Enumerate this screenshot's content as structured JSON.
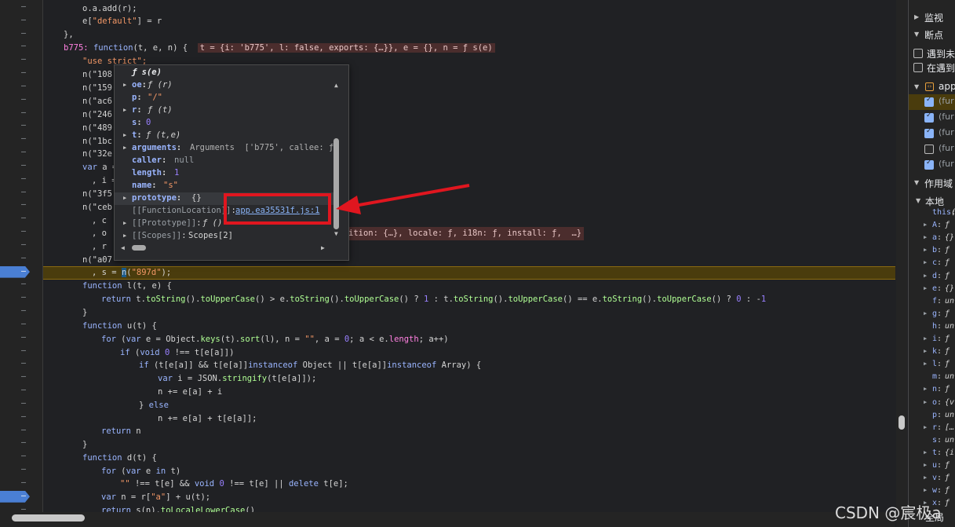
{
  "gutter": {
    "breakpoint_rows": [
      20,
      37
    ]
  },
  "code": {
    "l0": "o.a.add(r);",
    "l1a": "e[",
    "l1b": "\"default\"",
    "l1c": "] = r",
    "l2": "},",
    "l3a": "b775: ",
    "l3b": "function",
    "l3c": "(t, e, n) {",
    "l3d": "t = {i: 'b775', l: false, exports: {…}}, e = {}, n = ƒ s(e)",
    "l4": "\"use strict\";",
    "l5": "n(\"108",
    "l6": "n(\"159",
    "l7": "n(\"ac6",
    "l8": "n(\"246",
    "l9": "n(\"489",
    "l10": "n(\"1bc",
    "l11": "n(\"32e",
    "l12a": "var",
    "l12b": " a =",
    "l13": ", i =",
    "l14": "n(\"3f5",
    "l15": "n(\"ceb",
    "l16": ", c",
    "l17": ", o",
    "l17b": "ition: {…}, locale: ƒ, i18n: ƒ, install: ƒ,  …}",
    "l18": ", r",
    "l19": "n(\"a07",
    "l20a": ", s = ",
    "l20b": "n",
    "l20c": "(",
    "l20d": "\"897d\"",
    "l20e": ");",
    "l21a": "function",
    "l21b": " l(t, e) {",
    "l22a": "return",
    "l22b": " t.",
    "l22c": "toString",
    "l22d": "().",
    "l22e": "toUpperCase",
    "l22f": "() > e.",
    "l22g": "toString",
    "l22h": "().",
    "l22i": "toUpperCase",
    "l22j": "() ? ",
    "l22k": "1",
    "l22l": " : t.",
    "l22m": "toString",
    "l22n": "().",
    "l22o": "toUpperCase",
    "l22p": "() == e.",
    "l22q": "toString",
    "l22r": "().",
    "l22s": "toUpperCase",
    "l22t": "() ? ",
    "l22u": "0",
    "l22v": " : -",
    "l22w": "1",
    "l23": "}",
    "l24a": "function",
    "l24b": " u(t) {",
    "l25a": "for",
    "l25b": " (",
    "l25c": "var",
    "l25d": " e = Object.",
    "l25e": "keys",
    "l25f": "(t).",
    "l25g": "sort",
    "l25h": "(l), n = ",
    "l25i": "\"\"",
    "l25j": ", a = ",
    "l25k": "0",
    "l25l": "; a < e.",
    "l25m": "length",
    "l25n": "; a++)",
    "l26a": "if",
    "l26b": " (",
    "l26c": "void",
    "l26d": " ",
    "l26e": "0",
    "l26f": " !== t[e[a]])",
    "l27a": "if",
    "l27b": " (t[e[a]] && t[e[a]]",
    "l27c": "instanceof",
    "l27d": " Object || t[e[a]]",
    "l27e": "instanceof",
    "l27f": " Array) {",
    "l28a": "var",
    "l28b": " i = JSON.",
    "l28c": "stringify",
    "l28d": "(t[e[a]]);",
    "l29": "n += e[a] + i",
    "l30a": "} ",
    "l30b": "else",
    "l31": "n += e[a] + t[e[a]];",
    "l32a": "return",
    "l32b": " n",
    "l33": "}",
    "l34a": "function",
    "l34b": " d(t) {",
    "l35a": "for",
    "l35b": " (",
    "l35c": "var",
    "l35d": " e ",
    "l35e": "in",
    "l35f": " t)",
    "l36a": "\"\"",
    "l36b": " !== t[e] && ",
    "l36c": "void",
    "l36d": " ",
    "l36e": "0",
    "l36f": " !== t[e] || ",
    "l36g": "delete",
    "l36h": " t[e];",
    "l37a": "var",
    "l37b": " n = ",
    "l37c": "r[",
    "l37d": "\"a\"",
    "l37e": "] + ",
    "l37f": "u(t);",
    "l38a": "return",
    "l38b": " s(n).",
    "l38c": "toLocaleLowerCase",
    "l38d": "()"
  },
  "tooltip": {
    "title": "ƒ s(e)",
    "rows": [
      {
        "key": "oe",
        "val": "ƒ (r)"
      },
      {
        "key": "p",
        "val": "\"/\""
      },
      {
        "key": "r",
        "val": "ƒ (t)"
      },
      {
        "key": "s",
        "val": "0"
      },
      {
        "key": "t",
        "val": "ƒ (t,e)"
      },
      {
        "key": "arguments",
        "val": "Arguments  ['b775', callee: ƒ,"
      },
      {
        "key": "caller",
        "val": "null"
      },
      {
        "key": "length",
        "val": "1"
      },
      {
        "key": "name",
        "val": "\"s\""
      },
      {
        "key": "prototype",
        "val": "{}"
      },
      {
        "key": "[[FunctionLocation]]",
        "val": "app.ea35531f.js:1"
      },
      {
        "key": "[[Prototype]]",
        "val": "ƒ ()"
      },
      {
        "key": "[[Scopes]]",
        "val": "Scopes[2]"
      }
    ]
  },
  "sidebar": {
    "watch": "监视",
    "breakpoints": "断点",
    "pause_uncaught": "遇到未",
    "pause_caught": "在遇到",
    "file": "app",
    "fn": "(fur",
    "bp_checked": [
      true,
      true,
      true,
      false,
      true
    ],
    "scope": "作用域",
    "local": "本地",
    "vars": [
      {
        "k": "this",
        "v": "("
      },
      {
        "k": "A",
        "v": "ƒ"
      },
      {
        "k": "a",
        "v": "{}"
      },
      {
        "k": "b",
        "v": "ƒ"
      },
      {
        "k": "c",
        "v": "ƒ"
      },
      {
        "k": "d",
        "v": "ƒ"
      },
      {
        "k": "e",
        "v": "{}"
      },
      {
        "k": "f",
        "v": "un"
      },
      {
        "k": "g",
        "v": "ƒ"
      },
      {
        "k": "h",
        "v": "un"
      },
      {
        "k": "i",
        "v": "ƒ"
      },
      {
        "k": "k",
        "v": "ƒ"
      },
      {
        "k": "l",
        "v": "ƒ"
      },
      {
        "k": "m",
        "v": "un"
      },
      {
        "k": "n",
        "v": "ƒ"
      },
      {
        "k": "o",
        "v": "{v"
      },
      {
        "k": "p",
        "v": "un"
      },
      {
        "k": "r",
        "v": "[…"
      },
      {
        "k": "s",
        "v": "un"
      },
      {
        "k": "t",
        "v": "{i"
      },
      {
        "k": "u",
        "v": "ƒ"
      },
      {
        "k": "v",
        "v": "ƒ"
      },
      {
        "k": "w",
        "v": "ƒ"
      },
      {
        "k": "x",
        "v": "ƒ"
      }
    ],
    "global": "全局"
  },
  "watermark": "CSDN @宸极a"
}
